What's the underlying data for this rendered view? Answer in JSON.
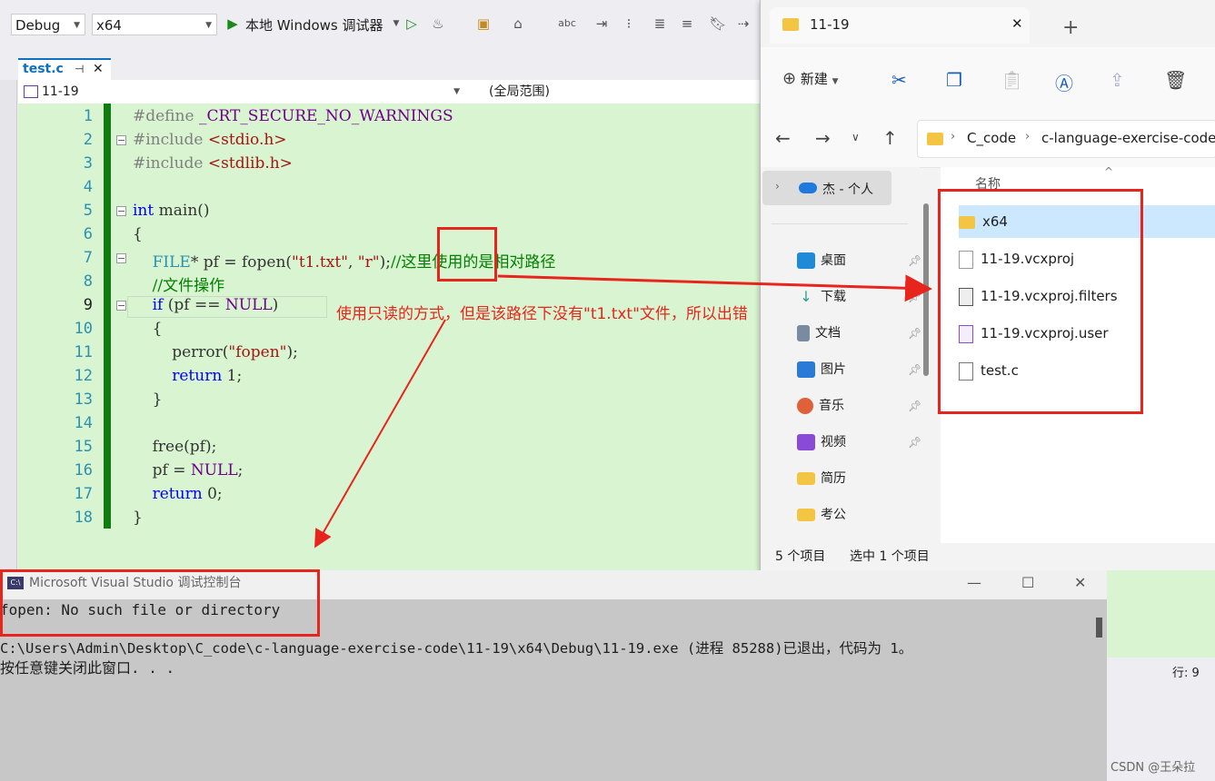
{
  "toolbar": {
    "config": "Debug",
    "platform": "x64",
    "debugger": "本地 Windows 调试器"
  },
  "editor": {
    "tab_label": "test.c",
    "tab_pin": "⊣",
    "tab_close": "✕",
    "scope": "11-19",
    "scope2": "(全局范围)",
    "line_numbers": [
      "1",
      "2",
      "3",
      "4",
      "5",
      "6",
      "7",
      "8",
      "9",
      "10",
      "11",
      "12",
      "13",
      "14",
      "15",
      "16",
      "17",
      "18"
    ],
    "lines": {
      "l1a": "#define ",
      "l1b": "_CRT_SECURE_NO_WARNINGS",
      "l2a": "#include ",
      "l2b": "<stdio.h>",
      "l3a": "#include ",
      "l3b": "<stdlib.h>",
      "l5a": "int",
      "l5b": " main()",
      "l6": "{",
      "l7a": "    ",
      "l7b": "FILE",
      "l7c": "* pf = fopen(",
      "l7d": "\"t1.txt\"",
      "l7e": ", ",
      "l7f": "\"r\"",
      "l7g": ");",
      "l7h": "//这里使用的是相对路径",
      "l8": "    //文件操作",
      "l9a": "    ",
      "l9b": "if",
      "l9c": " (pf == ",
      "l9d": "NULL",
      "l9e": ")",
      "l10": "    {",
      "l11a": "        perror(",
      "l11b": "\"fopen\"",
      "l11c": ");",
      "l12a": "        ",
      "l12b": "return",
      "l12c": " 1;",
      "l13": "    }",
      "l15": "    free(pf);",
      "l16a": "    pf = ",
      "l16b": "NULL",
      "l16c": ";",
      "l17a": "    ",
      "l17b": "return",
      "l17c": " 0;",
      "l18": "}"
    }
  },
  "annotation": "使用只读的方式，但是该路径下没有\"t1.txt\"文件，所以出错",
  "explorer": {
    "tab_title": "11-19",
    "tab_close": "✕",
    "tab_add": "+",
    "new_label": "新建",
    "breadcrumb": [
      "C_code",
      "c-language-exercise-code"
    ],
    "home_item": "杰 - 个人",
    "column_header": "名称",
    "nav_items": [
      {
        "label": "桌面",
        "color": "#1f8ad8"
      },
      {
        "label": "下载",
        "color": "#2aa08c"
      },
      {
        "label": "文档",
        "color": "#7a8aa0"
      },
      {
        "label": "图片",
        "color": "#2a7ad8"
      },
      {
        "label": "音乐",
        "color": "#e0603a"
      },
      {
        "label": "视频",
        "color": "#8a4ad8"
      },
      {
        "label": "简历",
        "color": "#f4c542"
      },
      {
        "label": "考公",
        "color": "#f4c542"
      }
    ],
    "files": [
      "x64",
      "11-19.vcxproj",
      "11-19.vcxproj.filters",
      "11-19.vcxproj.user",
      "test.c"
    ],
    "status_count": "5 个项目",
    "status_selected": "选中 1 个项目"
  },
  "console": {
    "title": "Microsoft Visual Studio 调试控制台",
    "line1": "fopen: No such file or directory",
    "line2": "C:\\Users\\Admin\\Desktop\\C_code\\c-language-exercise-code\\11-19\\x64\\Debug\\11-19.exe (进程 85288)已退出，代码为 1。",
    "line3": "按任意键关闭此窗口. . ."
  },
  "statusbar": {
    "line": "行: 9"
  },
  "watermark": "CSDN @王朵拉",
  "colors": {
    "annotation_red": "#e8251d",
    "editor_bg": "#d9f4d0"
  }
}
